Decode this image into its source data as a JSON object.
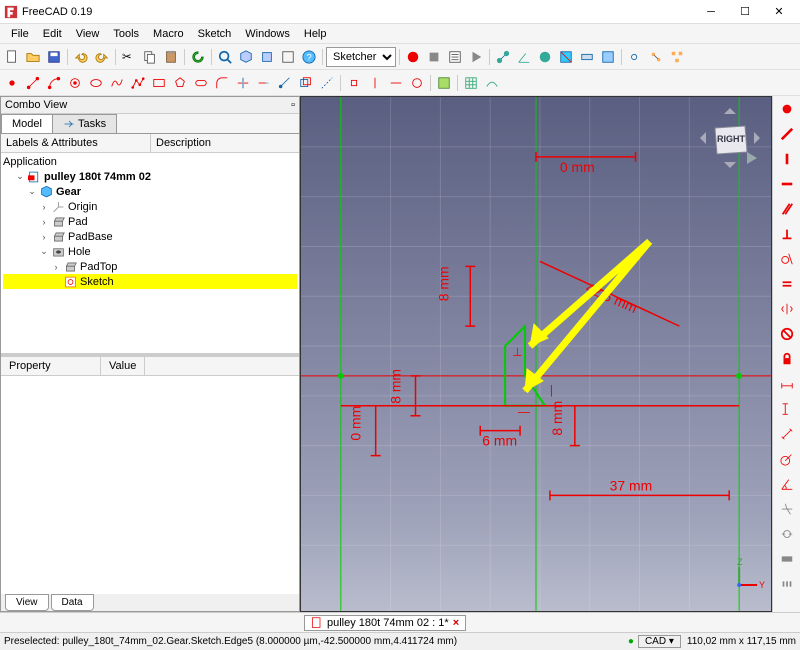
{
  "window": {
    "title": "FreeCAD 0.19"
  },
  "menus": [
    "File",
    "Edit",
    "View",
    "Tools",
    "Macro",
    "Sketch",
    "Windows",
    "Help"
  ],
  "workbench": {
    "selected": "Sketcher",
    "options": [
      "Sketcher"
    ],
    "icon": "sketcher-icon"
  },
  "combo": {
    "title": "Combo View",
    "tabs": {
      "model": "Model",
      "tasks": "Tasks"
    },
    "columns": {
      "labels": "Labels & Attributes",
      "desc": "Description"
    },
    "tree": {
      "application": "Application",
      "doc": "pulley 180t 74mm 02",
      "gear": "Gear",
      "origin": "Origin",
      "pad": "Pad",
      "padbase": "PadBase",
      "hole": "Hole",
      "padtop": "PadTop",
      "sketch": "Sketch"
    },
    "prop": {
      "property": "Property",
      "value": "Value"
    },
    "bottom_tabs": {
      "view": "View",
      "data": "Data"
    }
  },
  "dimensions": {
    "top": "0 mm",
    "v8_1": "8 mm",
    "v8_2": "8 mm",
    "v8_3": "0 mm",
    "v8_4": "8 mm",
    "h6": "6 mm",
    "diag": "42,5 mm",
    "h37": "37 mm"
  },
  "navcube": {
    "face": "RIGHT"
  },
  "doc_tab": {
    "label": "pulley 180t 74mm 02 : 1*"
  },
  "status": {
    "preselect": "Preselected: pulley_180t_74mm_02.Gear.Sketch.Edge5 (8.000000 µm,-42.500000 mm,4.411724 mm)",
    "cad": "CAD",
    "dims": "110,02 mm x 117,15 mm"
  },
  "colors": {
    "dim": "#e00000",
    "sketch": "#00cc00",
    "highlight": "#ffff00",
    "arrow": "#ffff00"
  }
}
